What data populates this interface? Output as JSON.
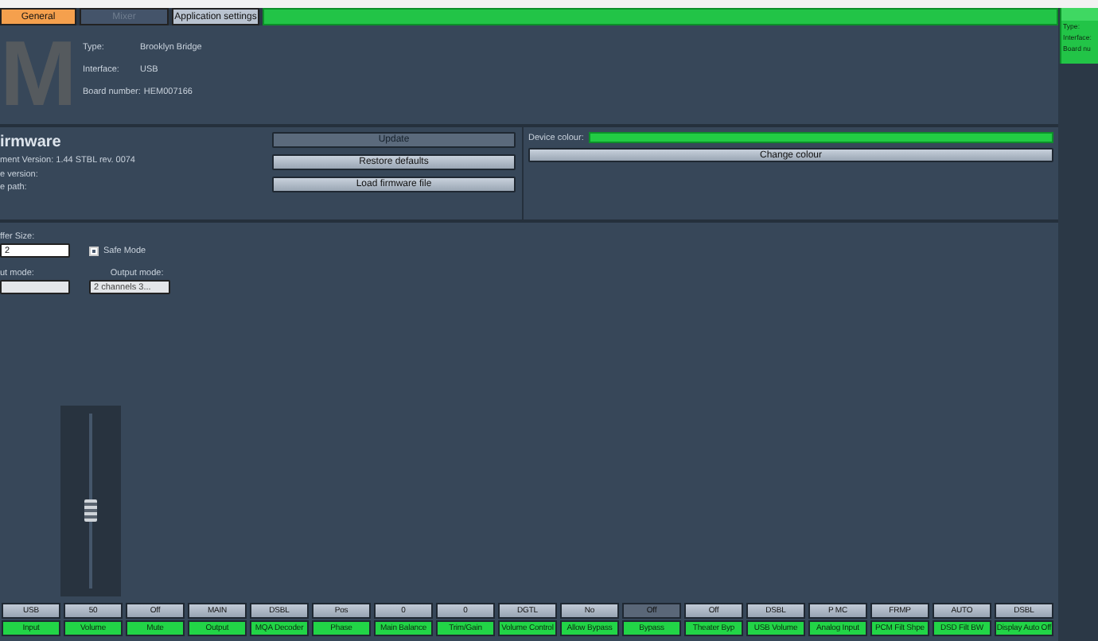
{
  "tabs": [
    {
      "label": "General",
      "selected": true,
      "disabled": false
    },
    {
      "label": "Mixer",
      "selected": false,
      "disabled": true
    },
    {
      "label": "Application settings",
      "selected": false,
      "disabled": false
    }
  ],
  "device": {
    "logo": "M",
    "fields": [
      {
        "label": "Type:",
        "value": "Brooklyn Bridge"
      },
      {
        "label": "Interface:",
        "value": "USB"
      },
      {
        "label": "Board number:",
        "value": "HEM007166"
      }
    ]
  },
  "firmware": {
    "title": "irmware",
    "lines": [
      "ment Version:   1.44  STBL  rev. 0074",
      "e version:",
      "e path:"
    ],
    "buttons": [
      {
        "label": "Update",
        "disabled": true
      },
      {
        "label": "Restore defaults",
        "disabled": false
      },
      {
        "label": "Load firmware file",
        "disabled": false
      }
    ],
    "colour_label": "Device colour:",
    "colour_button": "Change colour"
  },
  "settings": {
    "buffer_label": "ffer Size:",
    "buffer_value": "2",
    "safe_mode": {
      "label": "Safe Mode",
      "checked": true
    },
    "input_label": "ut mode:",
    "output_label": "Output mode:",
    "output_value": "2 channels 3..."
  },
  "volume_slider": {
    "level": 0.45
  },
  "controls": [
    {
      "value": "USB",
      "label": "Input",
      "selected": false
    },
    {
      "value": "50",
      "label": "Volume",
      "selected": false
    },
    {
      "value": "Off",
      "label": "Mute",
      "selected": false
    },
    {
      "value": "MAIN",
      "label": "Output",
      "selected": false
    },
    {
      "value": "DSBL",
      "label": "MQA Decoder",
      "selected": false
    },
    {
      "value": "Pos",
      "label": "Phase",
      "selected": false
    },
    {
      "value": "0",
      "label": "Main Balance",
      "selected": false
    },
    {
      "value": "0",
      "label": "Trim/Gain",
      "selected": false
    },
    {
      "value": "DGTL",
      "label": "Volume Control",
      "selected": false
    },
    {
      "value": "No",
      "label": "Allow Bypass",
      "selected": false
    },
    {
      "value": "Off",
      "label": "Bypass",
      "selected": true
    },
    {
      "value": "Off",
      "label": "Theater Byp",
      "selected": false
    },
    {
      "value": "DSBL",
      "label": "USB Volume",
      "selected": false
    },
    {
      "value": "P MC",
      "label": "Analog Input",
      "selected": false
    },
    {
      "value": "FRMP",
      "label": "PCM Filt Shpe",
      "selected": false
    },
    {
      "value": "AUTO",
      "label": "DSD Filt BW",
      "selected": false
    },
    {
      "value": "DSBL",
      "label": "Display Auto Off",
      "selected": false
    }
  ],
  "side_card": {
    "lines": [
      "Type:",
      "Interface:",
      "Board nu"
    ]
  }
}
